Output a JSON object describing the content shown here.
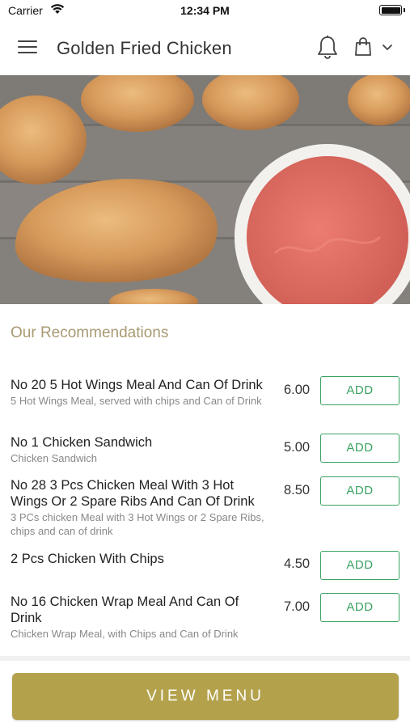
{
  "status_bar": {
    "carrier": "Carrier",
    "time": "12:34 PM",
    "wifi_icon": "wifi-icon",
    "battery_icon": "battery-icon"
  },
  "header": {
    "title": "Golden Fried Chicken",
    "icons": [
      "menu-icon",
      "bell-icon",
      "shopping-bag-icon",
      "chevron-down-icon"
    ]
  },
  "hero": {
    "image": "fried-chicken-with-ketchup-photo"
  },
  "recommendations": {
    "title": "Our Recommendations",
    "items": [
      {
        "name": "No 20 5 Hot Wings Meal And Can Of Drink",
        "description": "5 Hot Wings Meal, served with chips and Can of Drink",
        "price": "6.00",
        "button": "ADD"
      },
      {
        "name": "No 1 Chicken Sandwich",
        "description": "Chicken Sandwich",
        "price": "5.00",
        "button": "ADD"
      },
      {
        "name": "No 28 3 Pcs Chicken Meal With 3 Hot Wings Or 2 Spare Ribs And Can Of Drink",
        "description": "3 PCs chicken Meal with 3 Hot Wings or 2 Spare Ribs, chips and can of drink",
        "price": "8.50",
        "button": "ADD"
      },
      {
        "name": "2 Pcs Chicken With Chips",
        "description": "",
        "price": "4.50",
        "button": "ADD"
      },
      {
        "name": "No 16 Chicken Wrap Meal And Can Of Drink",
        "description": "Chicken Wrap Meal, with Chips and Can of Drink",
        "price": "7.00",
        "button": "ADD"
      }
    ]
  },
  "footer": {
    "view_menu_label": "VIEW MENU"
  },
  "colors": {
    "accent_gold": "#b4a14c",
    "section_title": "#a89a72",
    "add_green": "#3aa362"
  }
}
